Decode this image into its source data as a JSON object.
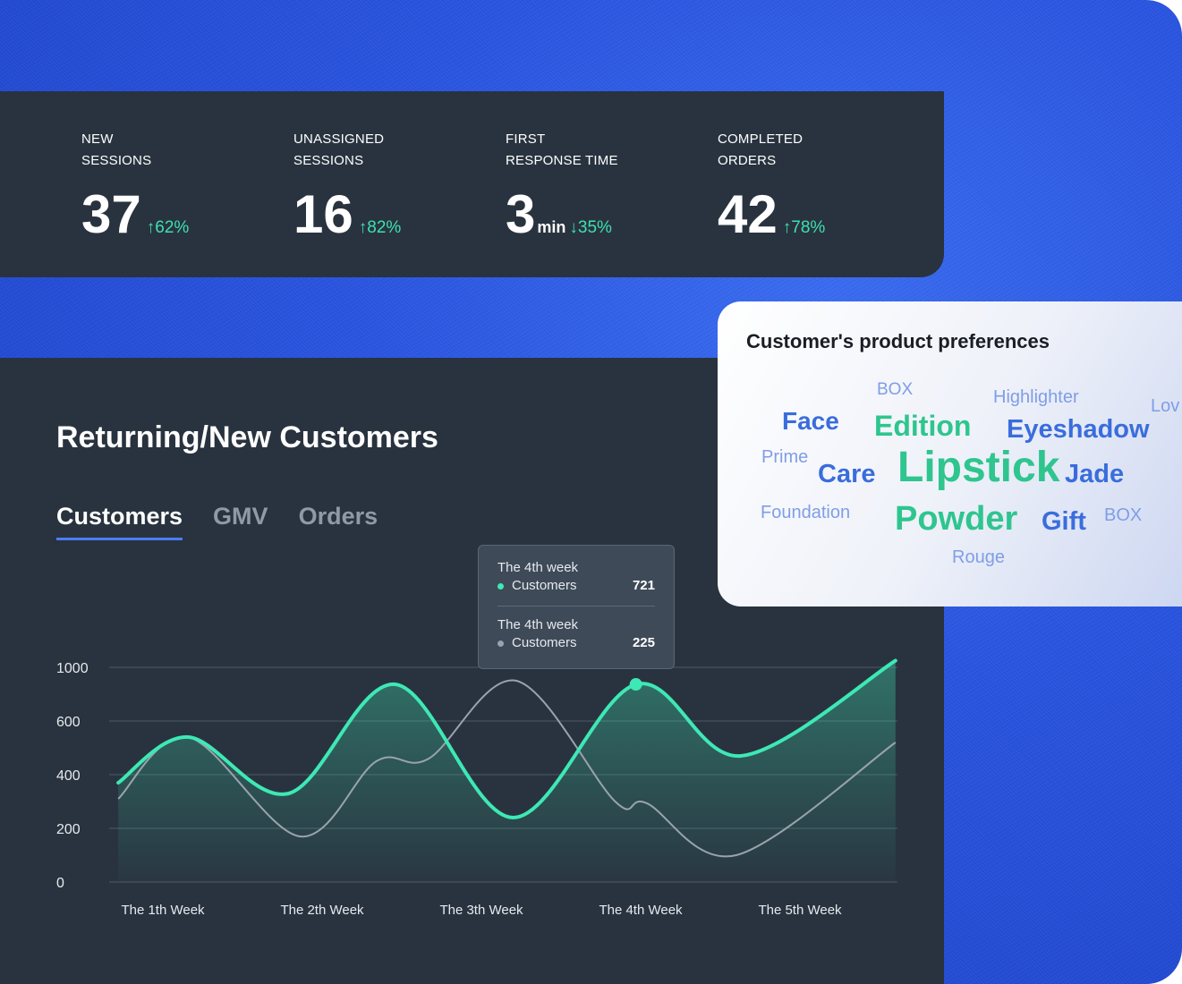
{
  "stats": [
    {
      "label": "NEW\nSESSIONS",
      "value": "37",
      "unit": "",
      "change": "↑62%"
    },
    {
      "label": "UNASSIGNED\nSESSIONS",
      "value": "16",
      "unit": "",
      "change": "↑82%"
    },
    {
      "label": "FIRST\nRESPONSE TIME",
      "value": "3",
      "unit": "min",
      "change": "↓35%"
    },
    {
      "label": "COMPLETED\nORDERS",
      "value": "42",
      "unit": "",
      "change": "↑78%"
    }
  ],
  "panel": {
    "title": "Returning/New Customers",
    "tabs": [
      "Customers",
      "GMV",
      "Orders"
    ],
    "active_tab": "Customers"
  },
  "tooltip": {
    "rows": [
      {
        "title": "The 4th week",
        "series": "Customers",
        "value": "721",
        "color": "#3ee8b5"
      },
      {
        "title": "The 4th week",
        "series": "Customers",
        "value": "225",
        "color": "#9aa3ad"
      }
    ]
  },
  "wordcloud": {
    "title": "Customer's product preferences",
    "words": [
      {
        "text": "BOX",
        "color": "#7f9ee6"
      },
      {
        "text": "Highlighter",
        "color": "#7f9ee6"
      },
      {
        "text": "Lov",
        "color": "#7f9ee6"
      },
      {
        "text": "Face",
        "color": "#3a6ddc"
      },
      {
        "text": "Edition",
        "color": "#2fc58e"
      },
      {
        "text": "Eyeshadow",
        "color": "#3a6ddc"
      },
      {
        "text": "Prime",
        "color": "#7f9ee6"
      },
      {
        "text": "Care",
        "color": "#3a6ddc"
      },
      {
        "text": "Lipstick",
        "color": "#2fc58e"
      },
      {
        "text": "Jade",
        "color": "#3a6ddc"
      },
      {
        "text": "Foundation",
        "color": "#7f9ee6"
      },
      {
        "text": "Powder",
        "color": "#2fc58e"
      },
      {
        "text": "Gift",
        "color": "#3a6ddc"
      },
      {
        "text": "BOX",
        "color": "#7f9ee6"
      },
      {
        "text": "Rouge",
        "color": "#7f9ee6"
      }
    ]
  },
  "chart_data": {
    "type": "line",
    "categories": [
      "The 1th Week",
      "The 2th Week",
      "The 3th Week",
      "The 4th Week",
      "The 5th Week"
    ],
    "yticks": [
      0,
      200,
      400,
      600,
      1000
    ],
    "grid": true,
    "series": [
      {
        "color": "#3ee8b5",
        "points": [
          [
            0.72,
            370
          ],
          [
            1.16,
            540
          ],
          [
            1.79,
            330
          ],
          [
            2.46,
            873
          ],
          [
            3.2,
            240
          ],
          [
            3.97,
            873
          ],
          [
            4.63,
            470
          ],
          [
            5.6,
            1050
          ]
        ]
      },
      {
        "color": "#9aa3ad",
        "points": [
          [
            0.72,
            310
          ],
          [
            1.16,
            540
          ],
          [
            1.86,
            170
          ],
          [
            2.34,
            450
          ],
          [
            2.67,
            460
          ],
          [
            3.22,
            900
          ],
          [
            3.84,
            300
          ],
          [
            4.04,
            293
          ],
          [
            4.6,
            100
          ],
          [
            5.6,
            520
          ]
        ]
      }
    ],
    "highlight": {
      "category": "The 4th Week",
      "value": 721
    }
  }
}
